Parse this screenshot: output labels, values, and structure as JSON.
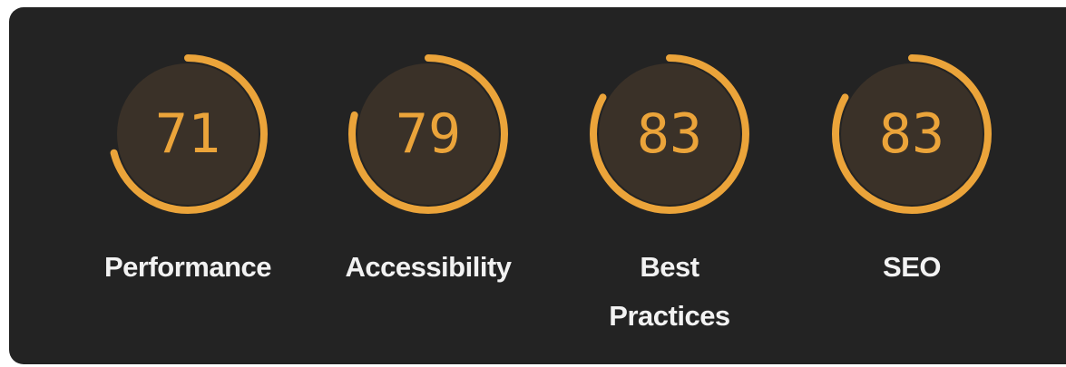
{
  "categories": [
    {
      "id": "performance",
      "score": 71,
      "score_text": "71",
      "label": "Performance"
    },
    {
      "id": "accessibility",
      "score": 79,
      "score_text": "79",
      "label": "Accessibility"
    },
    {
      "id": "best-practices",
      "score": 83,
      "score_text": "83",
      "label_lines": [
        "Best",
        "Practices"
      ]
    },
    {
      "id": "seo",
      "score": 83,
      "score_text": "83",
      "label": "SEO"
    }
  ],
  "colors": {
    "panel_background": "#232323",
    "gauge_arc": "#eba43a",
    "gauge_fill": "#3a3128",
    "score_text": "#eba43a",
    "label_text": "#f2f2f2"
  }
}
